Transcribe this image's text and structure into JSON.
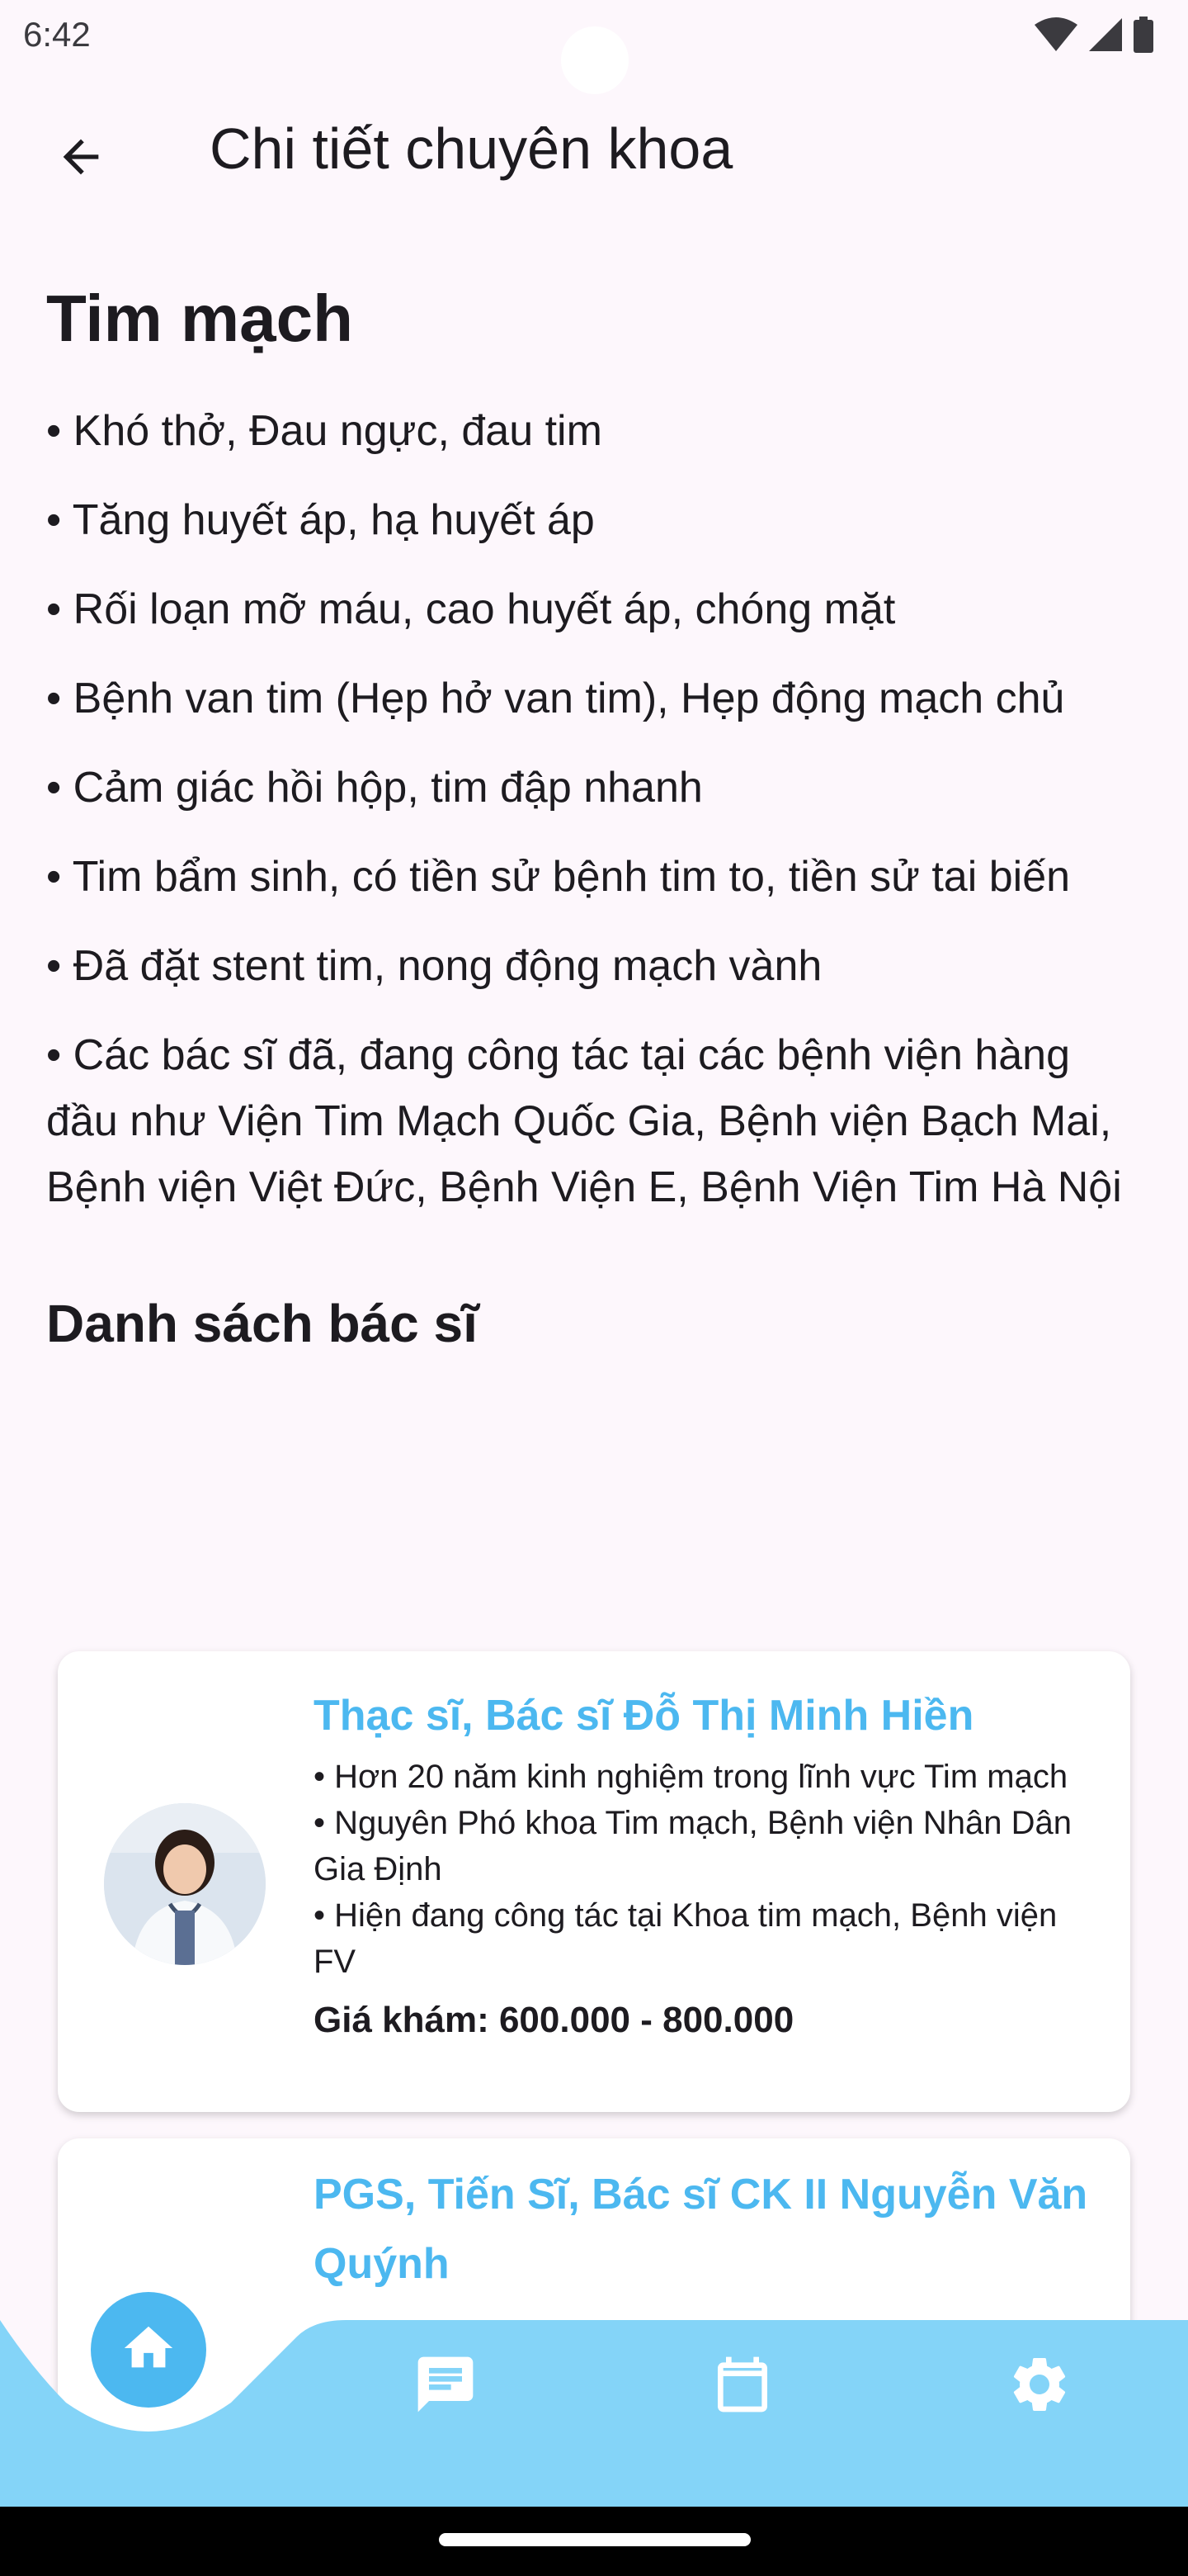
{
  "status_bar": {
    "time": "6:42",
    "icons": [
      "wifi-icon",
      "signal-icon",
      "battery-icon"
    ]
  },
  "app_bar": {
    "back_icon": "arrow-left-icon",
    "title": "Chi tiết chuyên khoa"
  },
  "specialty": {
    "title": "Tim mạch",
    "bullets": [
      "• Khó thở, Đau ngực, đau tim",
      "• Tăng huyết áp, hạ huyết áp",
      "• Rối loạn mỡ máu, cao huyết áp, chóng mặt",
      "• Bệnh van tim (Hẹp hở van tim), Hẹp động mạch chủ",
      "• Cảm giác hồi hộp, tim đập nhanh",
      "• Tim bẩm sinh, có tiền sử bệnh tim to, tiền sử tai biến",
      "• Đã đặt stent tim, nong động mạch vành",
      "• Các bác sĩ đã, đang công tác tại các bệnh viện hàng đầu như Viện Tim Mạch Quốc Gia, Bệnh viện Bạch Mai, Bệnh viện Việt Đức, Bệnh Viện E, Bệnh Viện Tim Hà Nội"
    ]
  },
  "doctors": {
    "section_title": "Danh sách bác sĩ",
    "list": [
      {
        "name": "Thạc sĩ, Bác sĩ Đỗ Thị Minh Hiền",
        "lines": [
          "• Hơn 20 năm kinh nghiệm trong lĩnh vực Tim mạch",
          "• Nguyên Phó khoa Tim mạch, Bệnh viện Nhân Dân Gia Định",
          "• Hiện đang công tác tại Khoa tim mạch, Bệnh viện FV"
        ],
        "price": "Giá khám: 600.000 - 800.000"
      },
      {
        "name": "PGS, Tiến Sĩ, Bác sĩ CK II Nguyễn Văn Quýnh"
      }
    ]
  },
  "bottom_nav": {
    "items": [
      {
        "icon": "home-icon",
        "active": true
      },
      {
        "icon": "chat-icon",
        "active": false
      },
      {
        "icon": "calendar-icon",
        "active": false
      },
      {
        "icon": "settings-icon",
        "active": false
      }
    ],
    "colors": {
      "bar": "#84d4f8",
      "active": "#4cb8f0",
      "icon": "#ffffff"
    }
  },
  "colors": {
    "background": "#fdf7fc",
    "accent": "#4cb8f0",
    "text": "#1d1b20"
  }
}
